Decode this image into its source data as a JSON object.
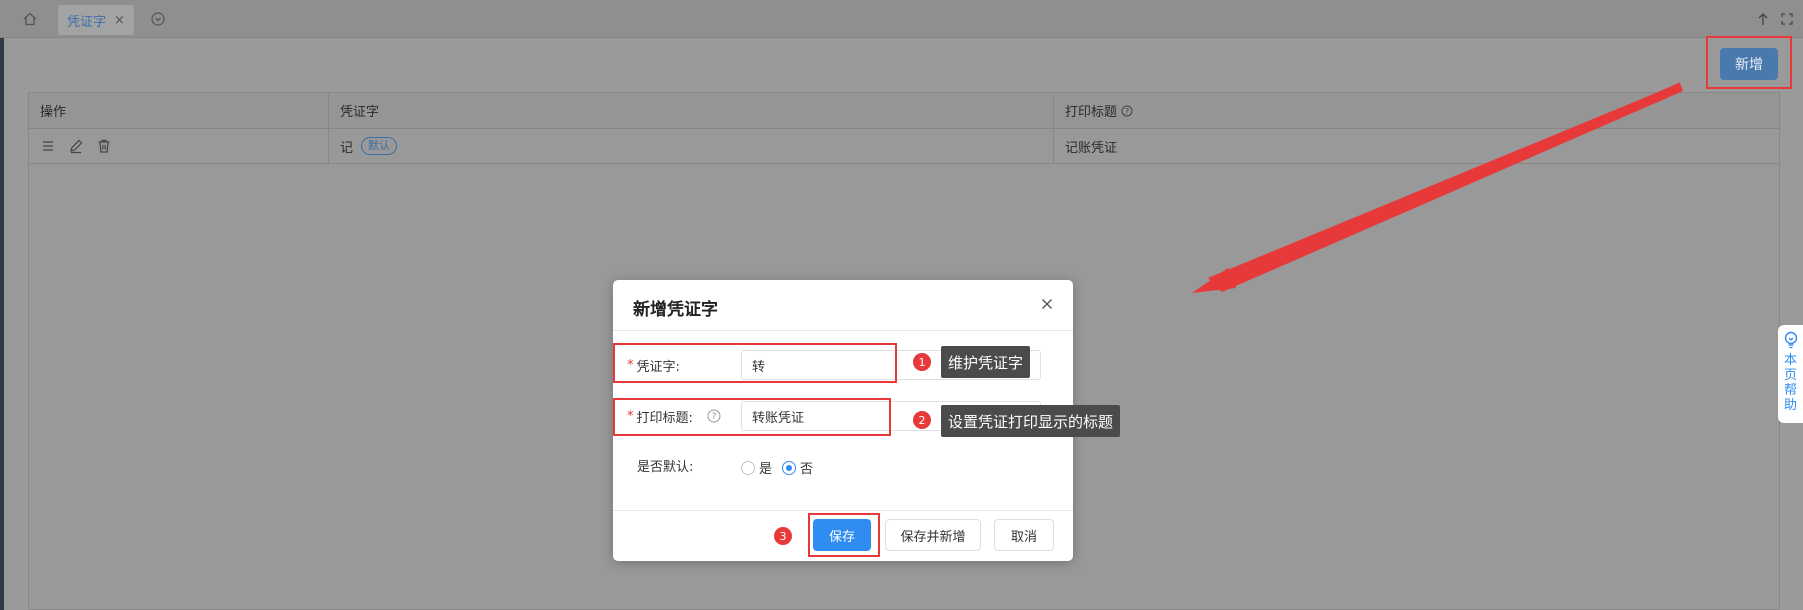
{
  "tabbar": {
    "home_icon": "home-icon",
    "active_tab_label": "凭证字",
    "close_glyph": "×"
  },
  "toolbar": {
    "add_label": "新增"
  },
  "table": {
    "headers": [
      "操作",
      "凭证字",
      "打印标题"
    ],
    "rows": [
      {
        "word": "记",
        "badge": "默认",
        "print_title": "记账凭证"
      }
    ]
  },
  "side_help": {
    "label": "本页帮助"
  },
  "dialog": {
    "title": "新增凭证字",
    "fields": {
      "word_label": "凭证字:",
      "word_value": "转",
      "print_title_label": "打印标题:",
      "print_title_value": "转账凭证",
      "default_label": "是否默认:",
      "radio_yes": "是",
      "radio_no": "否",
      "default_selected": "否"
    },
    "buttons": {
      "save": "保存",
      "save_and_new": "保存并新增",
      "cancel": "取消"
    }
  },
  "annotations": {
    "step1_num": "1",
    "step1_text": "维护凭证字",
    "step2_num": "2",
    "step2_text": "设置凭证打印显示的标题",
    "step3_num": "3"
  },
  "colors": {
    "primary": "#2f8cf0",
    "annotation_red": "#e8393a",
    "required": "#e53935"
  }
}
